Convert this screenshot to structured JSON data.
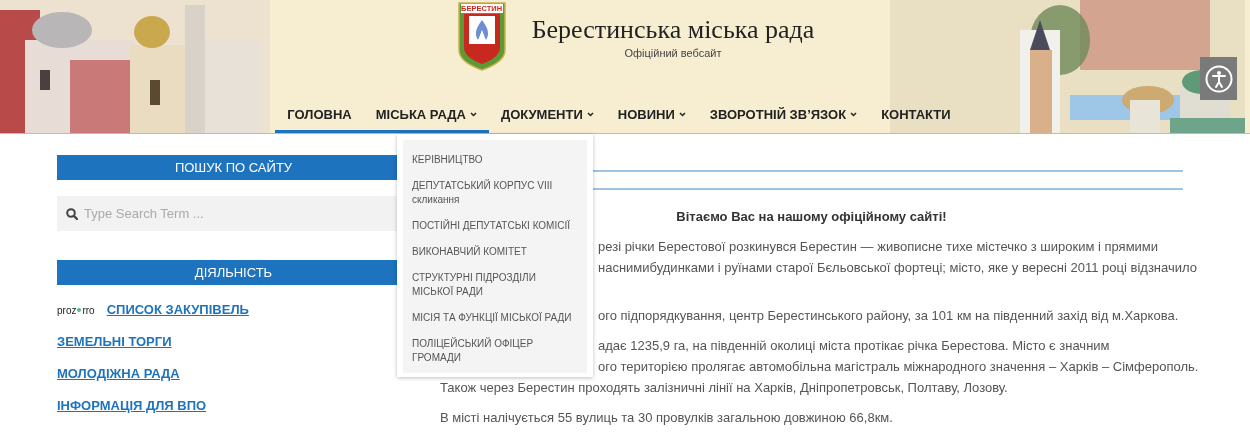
{
  "header": {
    "logo_text": "БЕРЕСТИН",
    "title": "Берестинська міська рада",
    "subtitle": "Офіційний вебсайт"
  },
  "nav": [
    {
      "label": "ГОЛОВНА",
      "selected": true,
      "has_submenu": false
    },
    {
      "label": "МІСЬКА РАДА",
      "selected": true,
      "has_submenu": true
    },
    {
      "label": "ДОКУМЕНТИ",
      "selected": false,
      "has_submenu": true
    },
    {
      "label": "НОВИНИ",
      "selected": false,
      "has_submenu": true
    },
    {
      "label": "ЗВОРОТНІЙ ЗВ’ЯЗОК",
      "selected": false,
      "has_submenu": true
    },
    {
      "label": "КОНТАКТИ",
      "selected": false,
      "has_submenu": false
    }
  ],
  "dropdown": [
    "КЕРІВНИЦТВО",
    "ДЕПУТАТСЬКИЙ КОРПУС VIII скликання",
    "ПОСТІЙНІ ДЕПУТАТСЬКІ КОМІСІЇ",
    "ВИКОНАВЧИЙ КОМІТЕТ",
    "СТРУКТУРНІ ПІДРОЗДІЛИ МІСЬКОЇ РАДИ",
    "МІСІЯ ТА ФУНКЦІЇ МІСЬКОЇ РАДИ",
    "ПОЛІЦЕЙСЬКИЙ ОФІЦЕР ГРОМАДИ"
  ],
  "sidebar": {
    "search_heading": "ПОШУК ПО САЙТУ",
    "search": {
      "placeholder": "Type Search Term ..."
    },
    "activity_heading": "ДІЯЛЬНІСТЬ",
    "links": [
      {
        "label": "СПИСОК ЗАКУПІВЕЛЬ",
        "logo": [
          "proz",
          "rro"
        ]
      },
      {
        "label": "ЗЕМЕЛЬНІ ТОРГИ"
      },
      {
        "label": "МОЛОДІЖНА РАДА"
      },
      {
        "label": "ІНФОРМАЦІЯ ДЛЯ ВПО"
      }
    ]
  },
  "content": {
    "heading": "Вітаємо Вас на нашому офіційному сайті!",
    "paragraphs": [
      [
        {
          "text": "резі річки Берестової розкинувся Берестин — живописне тихе містечко з широким і прямими",
          "covered": true
        },
        {
          "text": "наснимибудинками і руїнами старої Бєльовської фортеці; місто, яке у вересні 2011 році відзначило",
          "covered": true
        }
      ],
      [
        {
          "text": "ого підпорядкування, центр Берестинського району, за 101 км на південний захід від м.Харкова.",
          "covered": true
        }
      ],
      [
        {
          "text": "адає 1235,9 га, на південній околиці міста протікає річка Берестова. Місто є значним",
          "covered": true
        },
        {
          "text": "ого територією пролягає автомобільна магістраль міжнародного значення – Харків – Сімферополь.",
          "covered": true
        },
        {
          "text": "Також через Берестин проходять залізничні лінії на Харків, Дніпропетровськ, Полтаву, Лозову."
        }
      ],
      [
        {
          "text": "В місті налічується 55 вулиць та 30 провулків загальною довжиною 66,8км."
        }
      ]
    ]
  }
}
